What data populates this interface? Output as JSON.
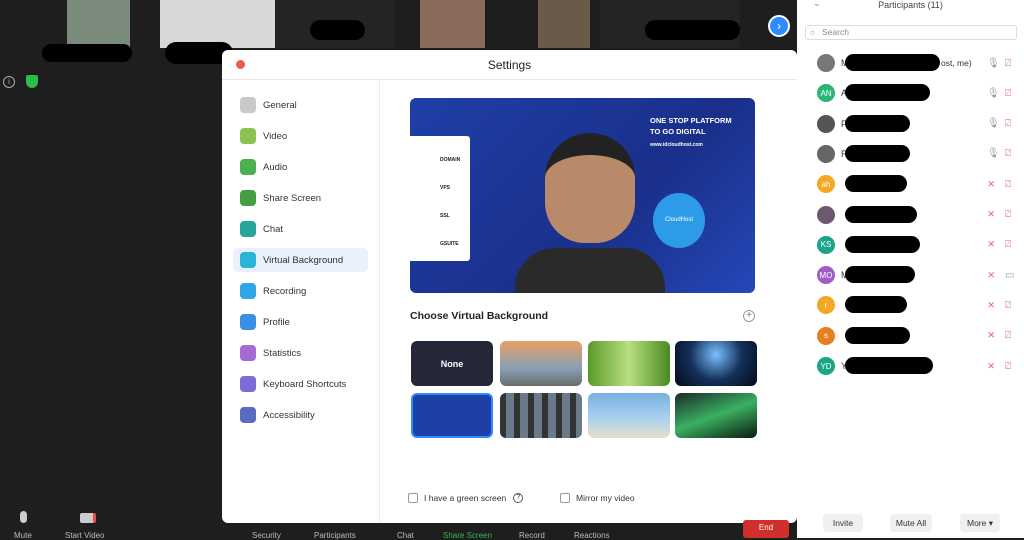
{
  "meeting": {
    "info_icon": "info-icon",
    "security_icon": "shield-icon"
  },
  "settings": {
    "title": "Settings",
    "nav": [
      {
        "label": "General",
        "color": "#c8c8c8"
      },
      {
        "label": "Video",
        "color": "#8cc152"
      },
      {
        "label": "Audio",
        "color": "#4caf50"
      },
      {
        "label": "Share Screen",
        "color": "#43a047"
      },
      {
        "label": "Chat",
        "color": "#26a69a"
      },
      {
        "label": "Virtual Background",
        "color": "#29b6d6",
        "active": true
      },
      {
        "label": "Recording",
        "color": "#2ea7e8"
      },
      {
        "label": "Profile",
        "color": "#3b8fe6"
      },
      {
        "label": "Statistics",
        "color": "#a66bd3"
      },
      {
        "label": "Keyboard Shortcuts",
        "color": "#7e6bd3"
      },
      {
        "label": "Accessibility",
        "color": "#5c6bc0"
      }
    ],
    "preview": {
      "headline1": "ONE STOP PLATFORM",
      "headline2": "TO GO DIGITAL",
      "url": "www.idcloudhost.com",
      "items": [
        "DOMAIN",
        "VPS",
        "SSL",
        "GSUITE"
      ],
      "balloon": "CloudHost"
    },
    "choose_title": "Choose Virtual Background",
    "none_label": "None",
    "green_screen_label": "I have a green screen",
    "mirror_label": "Mirror my video"
  },
  "toolbar": {
    "mute": "Mute",
    "start_video": "Start Video",
    "items": [
      "Security",
      "Participants",
      "Chat",
      "Share Screen",
      "Record",
      "Reactions"
    ],
    "end": "End",
    "share_color": "#2dbb4e"
  },
  "participants": {
    "title": "Participants (11)",
    "search_placeholder": "Search",
    "rows": [
      {
        "initials": "",
        "color": "#777",
        "photo": true,
        "name": "M",
        "suffix": "ost, me)",
        "mic": "on",
        "video": "off"
      },
      {
        "initials": "AN",
        "color": "#2bb673",
        "name": "A",
        "mic": "on",
        "video": "off"
      },
      {
        "initials": "",
        "color": "#555",
        "photo": true,
        "name": "F",
        "mic": "on",
        "video": "off"
      },
      {
        "initials": "",
        "color": "#666",
        "photo": true,
        "name": "R",
        "mic": "on",
        "video": "off"
      },
      {
        "initials": "ah",
        "color": "#f5a623",
        "name": "",
        "mic": "off",
        "video": "off"
      },
      {
        "initials": "",
        "color": "#6b5a6e",
        "photo": true,
        "name": "",
        "mic": "off",
        "video": "off"
      },
      {
        "initials": "KS",
        "color": "#1aa58a",
        "name": "",
        "mic": "off",
        "video": "off"
      },
      {
        "initials": "MO",
        "color": "#a05cc9",
        "name": "M",
        "mic": "off",
        "video": "on"
      },
      {
        "initials": "r",
        "color": "#f5a623",
        "name": "",
        "mic": "off",
        "video": "off"
      },
      {
        "initials": "s",
        "color": "#e67e22",
        "name": "",
        "mic": "off",
        "video": "off"
      },
      {
        "initials": "YD",
        "color": "#1aa58a",
        "name": "Y",
        "mic": "off",
        "video": "off"
      }
    ],
    "invite": "Invite",
    "mute_all": "Mute All",
    "more": "More ▾"
  }
}
